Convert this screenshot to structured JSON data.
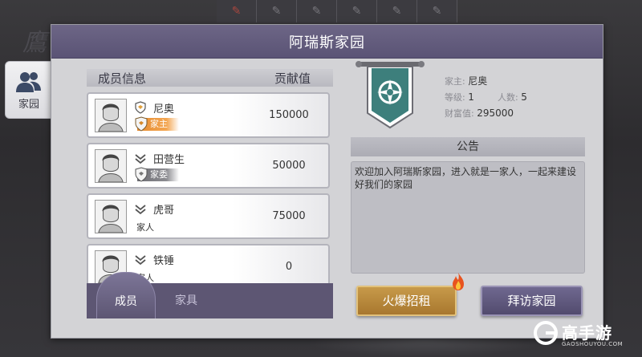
{
  "window": {
    "title": "阿瑞斯家园"
  },
  "side_tab": {
    "label": "家园",
    "icon": "group-icon"
  },
  "member_list": {
    "header": {
      "info": "成员信息",
      "contribution": "贡献值"
    },
    "members": [
      {
        "name": "尼奥",
        "role": "家主",
        "contribution": "150000",
        "rank_icon": "leader-shield-icon"
      },
      {
        "name": "田营生",
        "role": "家委",
        "contribution": "50000",
        "rank_icon": "chevron-rank-icon"
      },
      {
        "name": "虎哥",
        "role": "家人",
        "contribution": "75000",
        "rank_icon": "chevron-rank-icon"
      },
      {
        "name": "铁锤",
        "role": "家人",
        "contribution": "0",
        "rank_icon": "chevron-rank-icon"
      }
    ]
  },
  "bottom_tabs": {
    "members": "成员",
    "furniture": "家具"
  },
  "family_info": {
    "leader_label": "家主:",
    "leader": "尼奥",
    "level_label": "等级:",
    "level": "1",
    "count_label": "人数:",
    "count": "5",
    "wealth_label": "财富值:",
    "wealth": "295000"
  },
  "notice": {
    "title": "公告",
    "text": "欢迎加入阿瑞斯家园，进入就是一家人，一起来建设好我们的家园"
  },
  "buttons": {
    "recruit": "火爆招租",
    "visit": "拜访家园"
  },
  "watermark": {
    "cn": "高手游",
    "en": "GAOSHOUYOU.COM"
  },
  "colors": {
    "header": "#5a5375",
    "leader_badge": "#e58a2f",
    "recruit_button": "#b98a3c",
    "visit_button": "#5d5673",
    "emblem": "#3d7f7c"
  }
}
